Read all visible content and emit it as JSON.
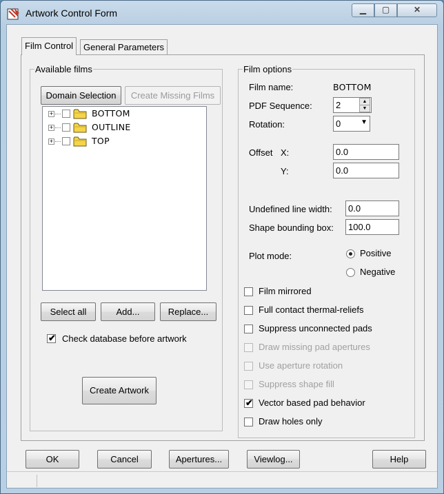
{
  "window": {
    "title": "Artwork Control Form",
    "min_glyph": "▁",
    "max_glyph": "▢",
    "close_glyph": "✕"
  },
  "tabs": [
    {
      "label": "Film Control",
      "active": true
    },
    {
      "label": "General Parameters",
      "active": false
    }
  ],
  "available_films": {
    "group_label": "Available films",
    "domain_selection_label": "Domain Selection",
    "create_missing_films_label": "Create Missing Films",
    "films": [
      {
        "name": "BOTTOM",
        "expander": "+"
      },
      {
        "name": "OUTLINE",
        "expander": "+"
      },
      {
        "name": "TOP",
        "expander": "+"
      }
    ],
    "select_all_label": "Select all",
    "add_label": "Add...",
    "replace_label": "Replace...",
    "check_database_label": "Check database before artwork",
    "check_database_checked": true,
    "create_artwork_label": "Create Artwork"
  },
  "film_options": {
    "group_label": "Film options",
    "film_name_label": "Film name:",
    "film_name_value": "BOTTOM",
    "pdf_sequence_label": "PDF Sequence:",
    "pdf_sequence_value": "2",
    "rotation_label": "Rotation:",
    "rotation_value": "0",
    "offset_label": "Offset",
    "offset_x_label": "X:",
    "offset_x_value": "0.0",
    "offset_y_label": "Y:",
    "offset_y_value": "0.0",
    "undefined_line_width_label": "Undefined line width:",
    "undefined_line_width_value": "0.0",
    "shape_bounding_box_label": "Shape bounding box:",
    "shape_bounding_box_value": "100.0",
    "plot_mode_label": "Plot mode:",
    "plot_mode_options": [
      "Positive",
      "Negative"
    ],
    "plot_mode_selected": "Positive",
    "checkboxes": [
      {
        "label": "Film mirrored",
        "checked": false,
        "enabled": true
      },
      {
        "label": "Full contact thermal-reliefs",
        "checked": false,
        "enabled": true
      },
      {
        "label": "Suppress unconnected pads",
        "checked": false,
        "enabled": true
      },
      {
        "label": "Draw missing pad apertures",
        "checked": false,
        "enabled": false
      },
      {
        "label": "Use aperture rotation",
        "checked": false,
        "enabled": false
      },
      {
        "label": "Suppress shape fill",
        "checked": false,
        "enabled": false
      },
      {
        "label": "Vector based pad behavior",
        "checked": true,
        "enabled": true
      },
      {
        "label": "Draw holes only",
        "checked": false,
        "enabled": true
      }
    ]
  },
  "footer": {
    "ok_label": "OK",
    "cancel_label": "Cancel",
    "apertures_label": "Apertures...",
    "viewlog_label": "Viewlog...",
    "help_label": "Help"
  },
  "check_glyph": "✔",
  "spin_up_glyph": "▲",
  "spin_down_glyph": "▼",
  "dropdown_glyph": "▼",
  "colors": {
    "folder": "#f5d44a",
    "title_icon": "#c0392b"
  }
}
